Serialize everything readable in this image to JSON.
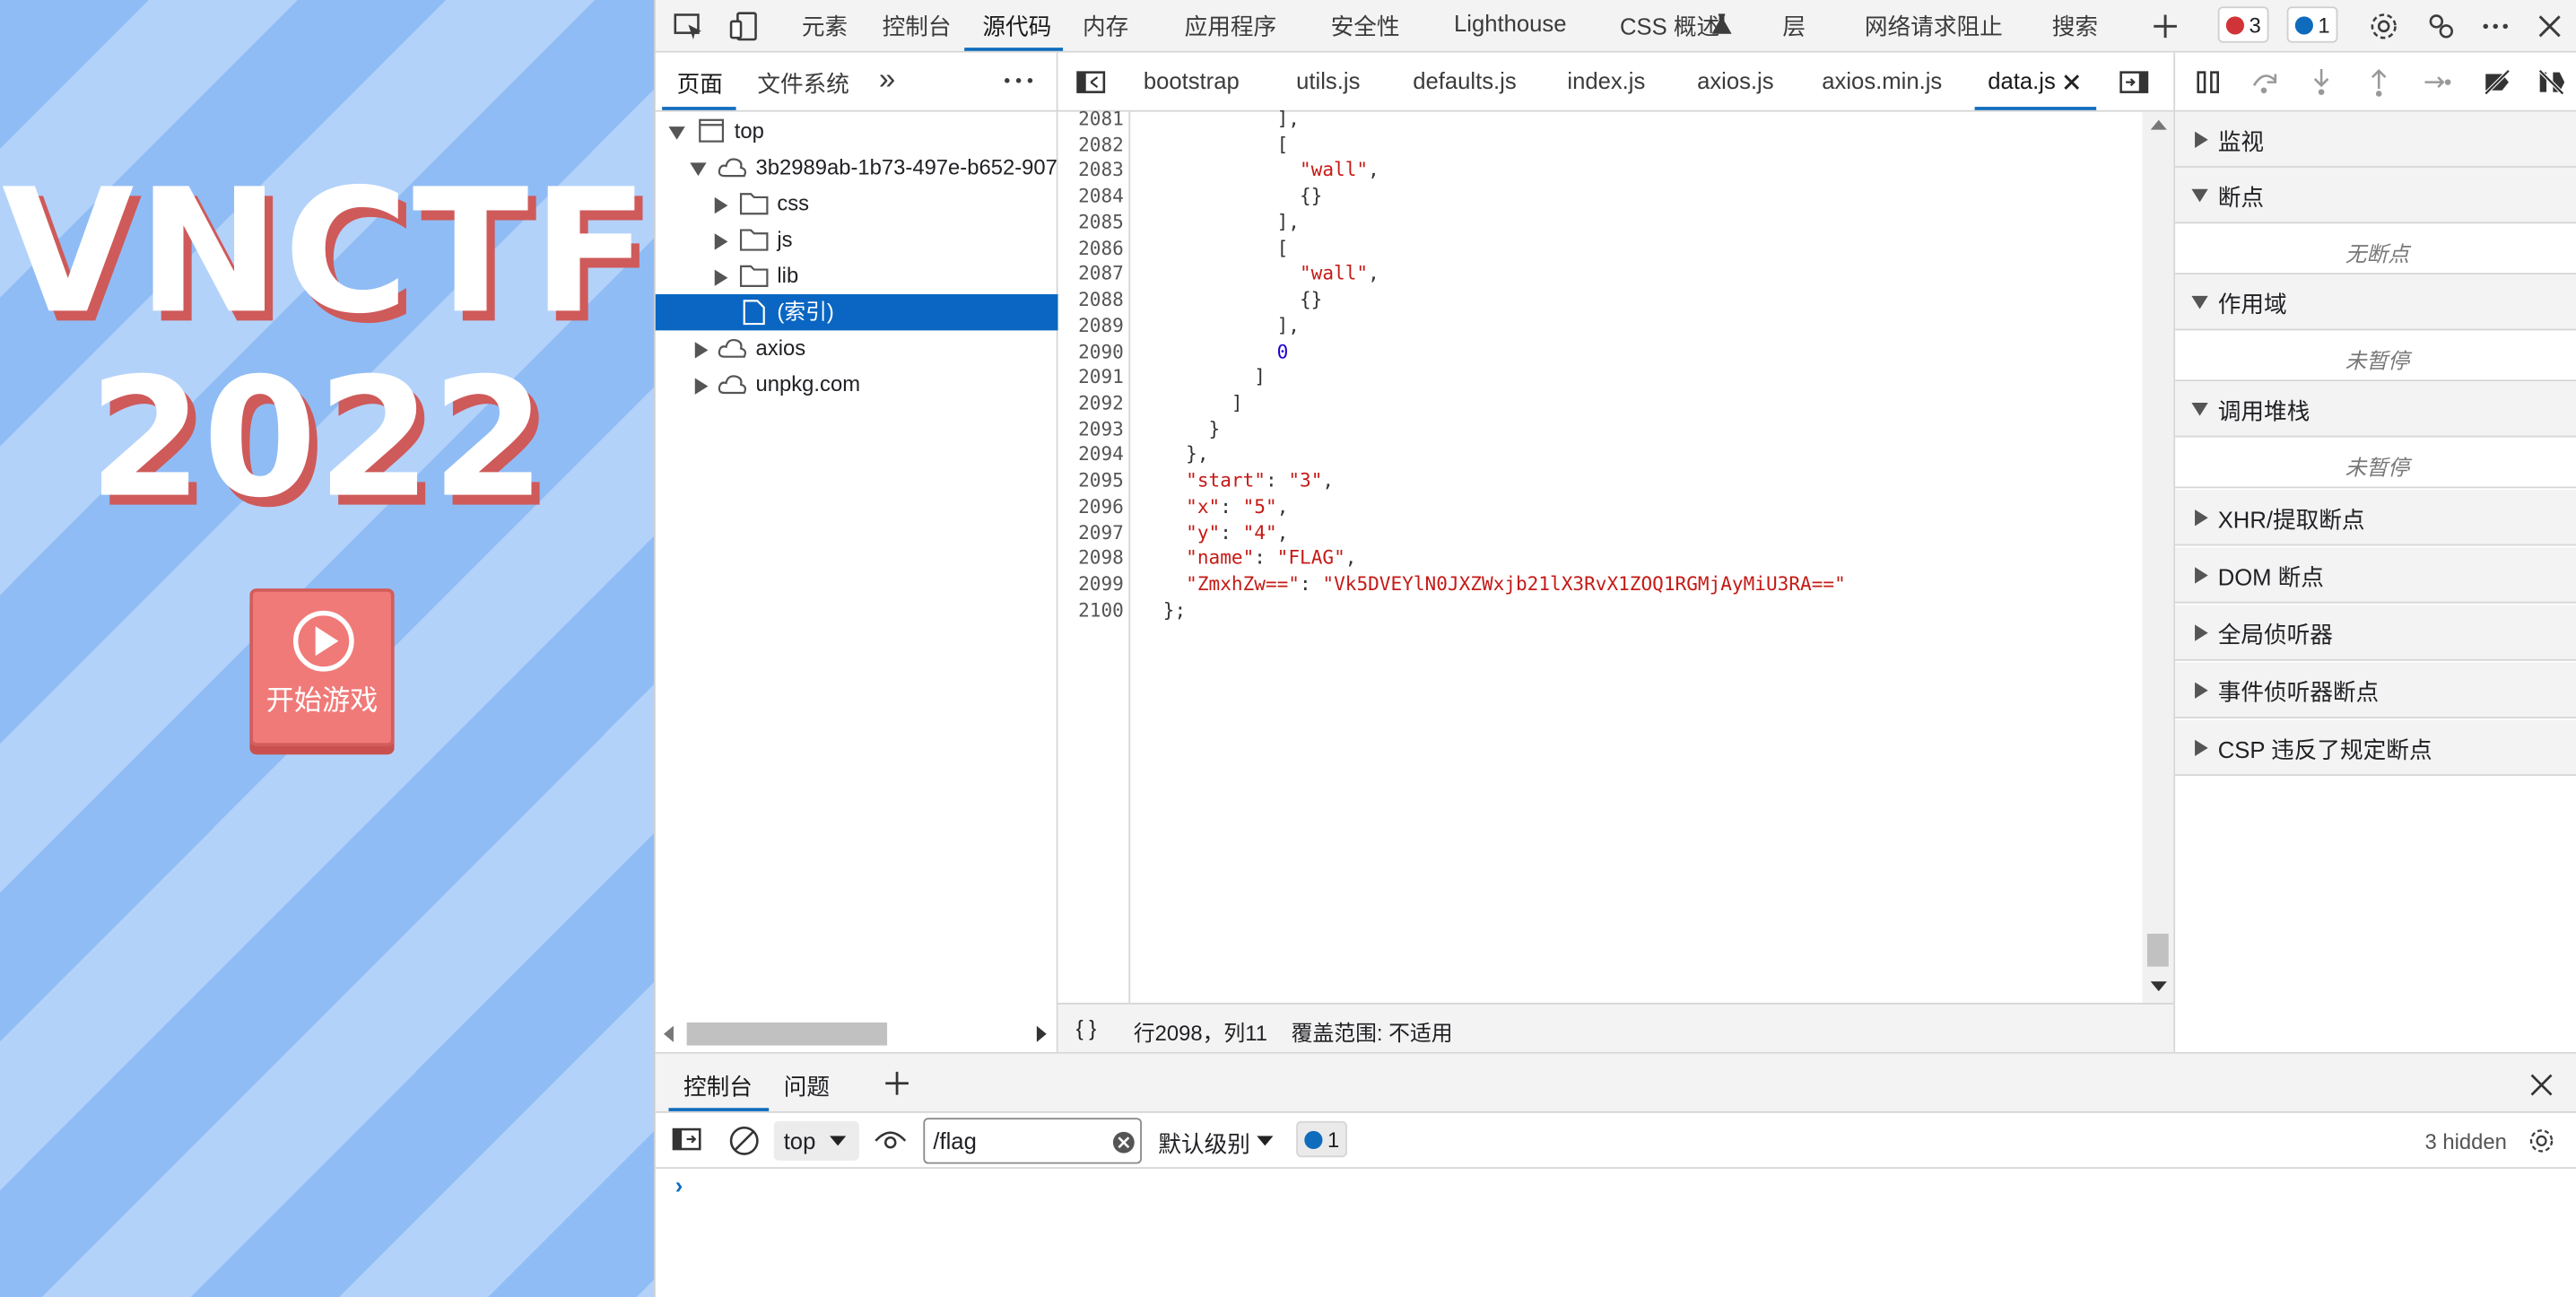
{
  "game": {
    "title_line1": "VNCTF",
    "title_line2": "2022",
    "start_button": "开始游戏"
  },
  "devtools": {
    "main_tabs": [
      "元素",
      "控制台",
      "源代码",
      "内存",
      "应用程序",
      "安全性",
      "Lighthouse",
      "CSS 概述",
      "层",
      "网络请求阻止",
      "搜索"
    ],
    "active_main_tab": "源代码",
    "error_count": "3",
    "message_count": "1",
    "navigator": {
      "tabs": [
        "页面",
        "文件系统"
      ],
      "active_tab": "页面",
      "tree": {
        "top": "top",
        "origin": "3b2989ab-1b73-497e-b652-907",
        "folders": [
          "css",
          "js",
          "lib"
        ],
        "index_file": "(索引)",
        "axios": "axios",
        "unpkg": "unpkg.com"
      }
    },
    "editor": {
      "tabs": [
        "bootstrap",
        "utils.js",
        "defaults.js",
        "index.js",
        "axios.js",
        "axios.min.js",
        "data.js"
      ],
      "active_tab": "data.js",
      "line_numbers": [
        "2081",
        "2082",
        "2083",
        "2084",
        "2085",
        "2086",
        "2087",
        "2088",
        "2089",
        "2090",
        "2091",
        "2092",
        "2093",
        "2094",
        "2095",
        "2096",
        "2097",
        "2098",
        "2099",
        "2100"
      ],
      "lines": [
        "          ],",
        "          [",
        "            \"wall\",",
        "            {}",
        "          ],",
        "          [",
        "            \"wall\",",
        "            {}",
        "          ],",
        "          0",
        "        ]",
        "      ]",
        "    }",
        "  },",
        "  \"start\": \"3\",",
        "  \"x\": \"5\",",
        "  \"y\": \"4\",",
        "  \"name\": \"FLAG\",",
        "  \"ZmxhZw==\": \"Vk5DVEYlN0JXZWxjb21lX3RvX1ZOQ1RGMjAyMiU3RA==\"",
        "};"
      ],
      "status": {
        "braces": "{ }",
        "position": "行2098，列11",
        "coverage": "覆盖范围: 不适用"
      }
    },
    "debugger": {
      "watch": "监视",
      "breakpoints": "断点",
      "no_breakpoints": "无断点",
      "scope": "作用域",
      "scope_paused": "未暂停",
      "callstack": "调用堆栈",
      "callstack_paused": "未暂停",
      "xhr": "XHR/提取断点",
      "dom": "DOM 断点",
      "global": "全局侦听器",
      "event": "事件侦听器断点",
      "csp": "CSP 违反了规定断点"
    },
    "drawer": {
      "tabs": [
        "控制台",
        "问题"
      ],
      "active_tab": "控制台",
      "context": "top",
      "filter_value": "/flag",
      "level": "默认级别",
      "issues_count": "1",
      "hidden": "3 hidden"
    }
  },
  "colors": {
    "accent": "#0f6cbd",
    "selection": "#0a66c2",
    "string": "#c41a16",
    "number": "#1c00cf",
    "game_button": "#f07a78",
    "title_shadow": "#cf5a5a"
  }
}
